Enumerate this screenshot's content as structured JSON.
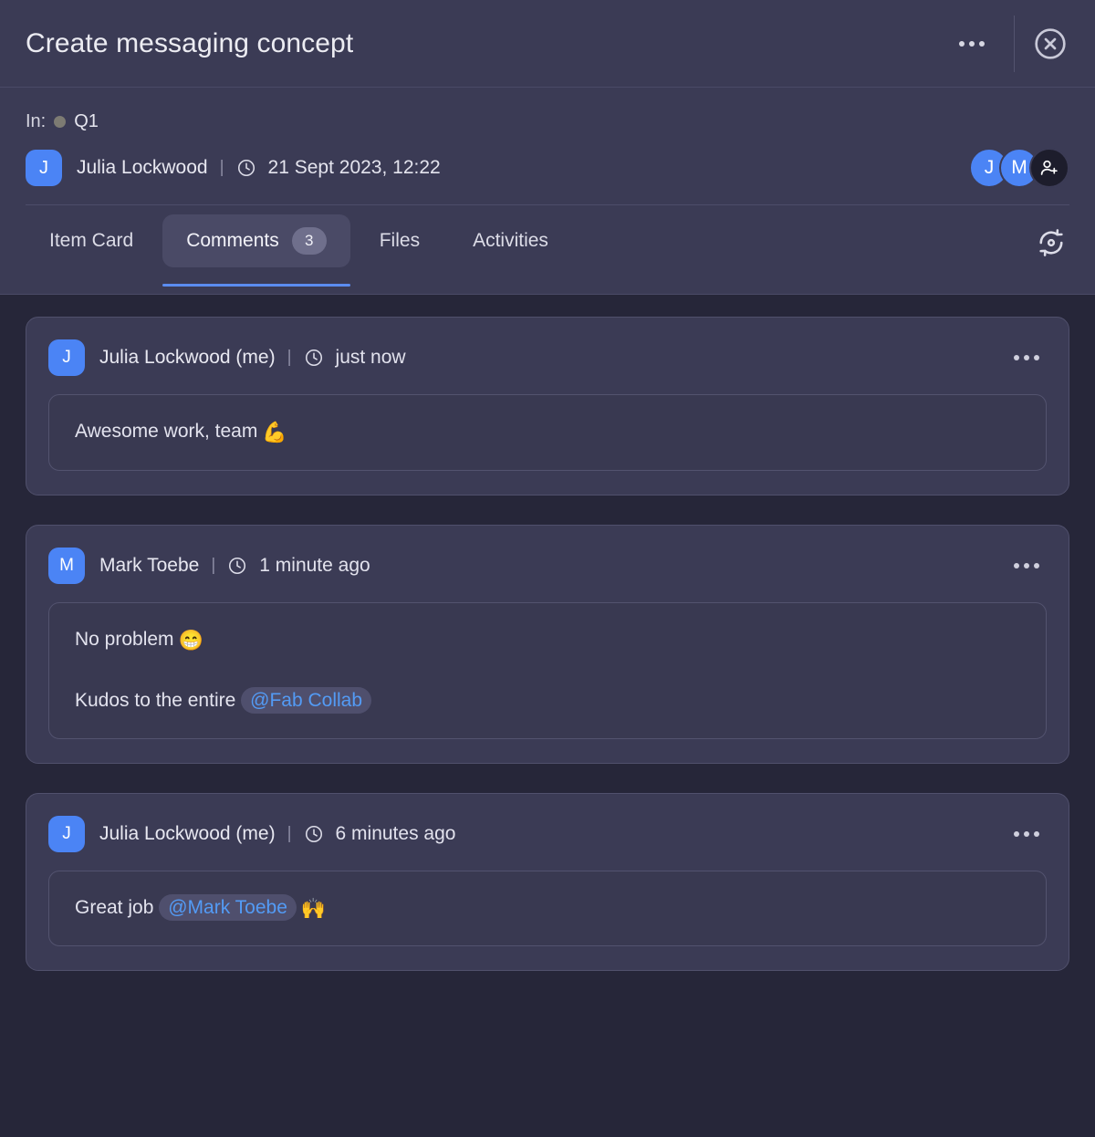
{
  "window": {
    "title": "Create messaging concept",
    "more_label": "more-options",
    "close_label": "close"
  },
  "meta": {
    "in_label": "In:",
    "board_name": "Q1",
    "board_status_color": "#7d7b73",
    "author_initial": "J",
    "author": "Julia Lockwood",
    "separator": "|",
    "timestamp": "21 Sept 2023, 12:22",
    "members": [
      {
        "initial": "J",
        "color": "#4b84f5"
      },
      {
        "initial": "M",
        "color": "#4b84f5"
      }
    ],
    "add_member_label": "add-member"
  },
  "tabs": {
    "items": [
      {
        "label": "Item Card",
        "badge": "",
        "active": false
      },
      {
        "label": "Comments",
        "badge": "3",
        "active": true
      },
      {
        "label": "Files",
        "badge": "",
        "active": false
      },
      {
        "label": "Activities",
        "badge": "",
        "active": false
      }
    ],
    "refresh_label": "refresh",
    "active_accent": "#5b8cf0"
  },
  "comments": [
    {
      "initial": "J",
      "author": "Julia Lockwood (me)",
      "separator": "|",
      "time": "just now",
      "lines": [
        {
          "text": "Awesome work, team",
          "emoji": "💪"
        }
      ]
    },
    {
      "initial": "M",
      "author": "Mark Toebe",
      "separator": "|",
      "time": "1 minute ago",
      "lines": [
        {
          "text": "No problem",
          "emoji": "😁"
        },
        {
          "text": "Kudos to the entire",
          "mention": "@Fab Collab"
        }
      ]
    },
    {
      "initial": "J",
      "author": "Julia Lockwood (me)",
      "separator": "|",
      "time": "6 minutes ago",
      "lines": [
        {
          "text": "Great job",
          "mention": "@Mark Toebe",
          "emoji": "🙌"
        }
      ]
    }
  ],
  "colors": {
    "page_bg": "#262639",
    "panel_bg": "#3b3b55",
    "card_bg": "#3b3b55",
    "accent_blue": "#5b8cf0",
    "mention_blue": "#539bf5"
  }
}
